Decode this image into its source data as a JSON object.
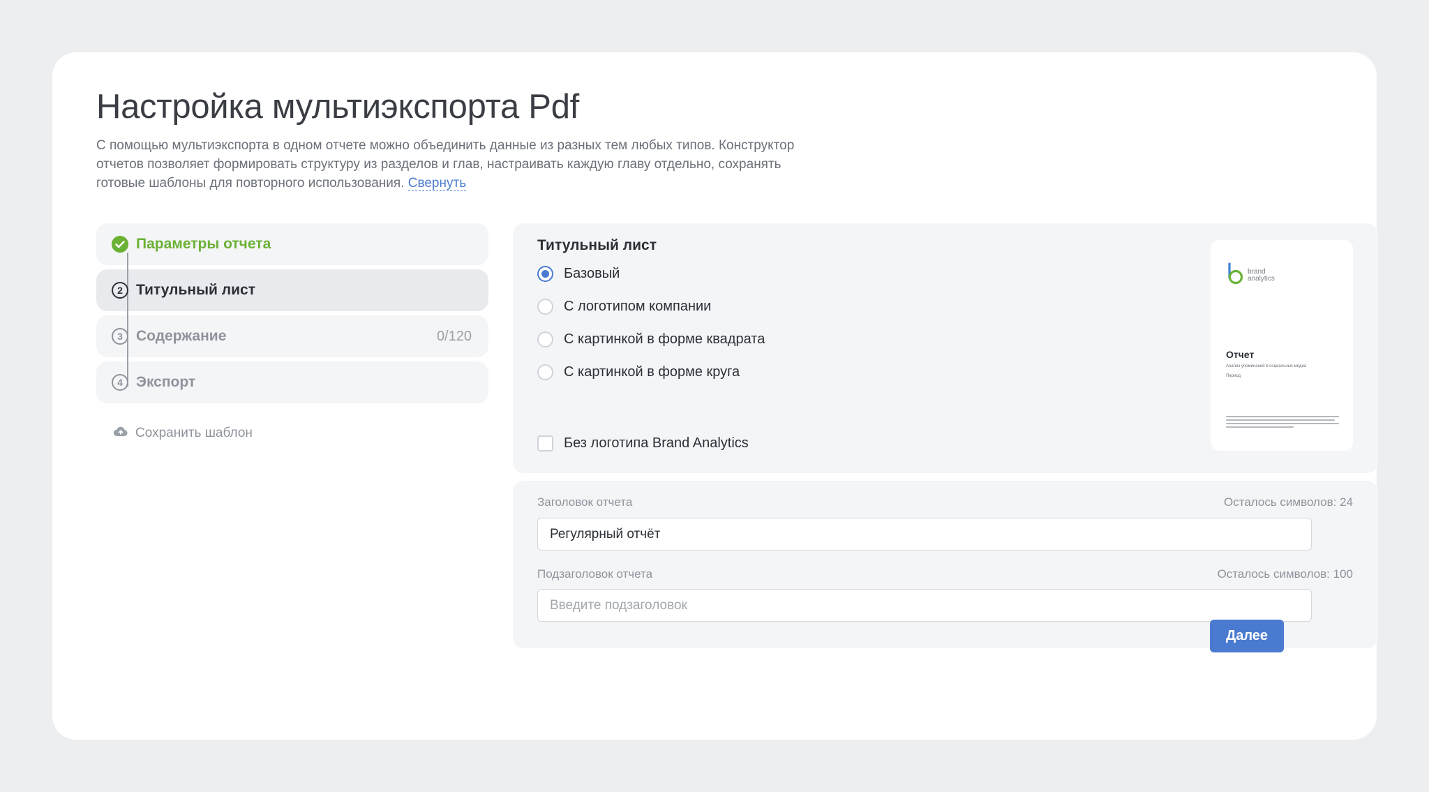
{
  "header": {
    "title": "Настройка мультиэкспорта Pdf",
    "description": "С помощью мультиэкспорта в одном отчете можно объединить данные из разных тем любых типов. Конструктор отчетов позволяет формировать структуру из разделов и глав, настраивать каждую главу отдельно, сохранять готовые шаблоны для повторного использования.",
    "collapse_link": "Свернуть"
  },
  "steps": [
    {
      "number": "",
      "label": "Параметры отчета",
      "state": "done",
      "count": ""
    },
    {
      "number": "2",
      "label": "Титульный лист",
      "state": "active",
      "count": ""
    },
    {
      "number": "3",
      "label": "Содержание",
      "state": "pending",
      "count": "0/120"
    },
    {
      "number": "4",
      "label": "Экспорт",
      "state": "pending",
      "count": ""
    }
  ],
  "save_template": {
    "label": "Сохранить шаблон",
    "icon": "cloud-upload-icon"
  },
  "title_page": {
    "heading": "Титульный лист",
    "options": [
      {
        "label": "Базовый",
        "checked": true
      },
      {
        "label": "С логотипом компании",
        "checked": false
      },
      {
        "label": "С картинкой в форме квадрата",
        "checked": false
      },
      {
        "label": "С картинкой в форме круга",
        "checked": false
      }
    ],
    "no_logo_checkbox": {
      "label": "Без логотипа Brand Analytics",
      "checked": false
    }
  },
  "preview": {
    "logo_line1": "brand",
    "logo_line2": "analytics",
    "title": "Отчет",
    "subtitle": "Анализ упоминаний в социальных медиа",
    "period": "Период"
  },
  "fields": {
    "report_title": {
      "label": "Заголовок отчета",
      "counter": "Осталось символов: 24",
      "value": "Регулярный отчёт",
      "placeholder": ""
    },
    "report_subtitle": {
      "label": "Подзаголовок отчета",
      "counter": "Осталось символов: 100",
      "value": "",
      "placeholder": "Введите подзаголовок"
    }
  },
  "actions": {
    "next_label": "Далее"
  },
  "colors": {
    "accent": "#4a7bd0",
    "success": "#6bb136",
    "background": "#edeef0"
  }
}
